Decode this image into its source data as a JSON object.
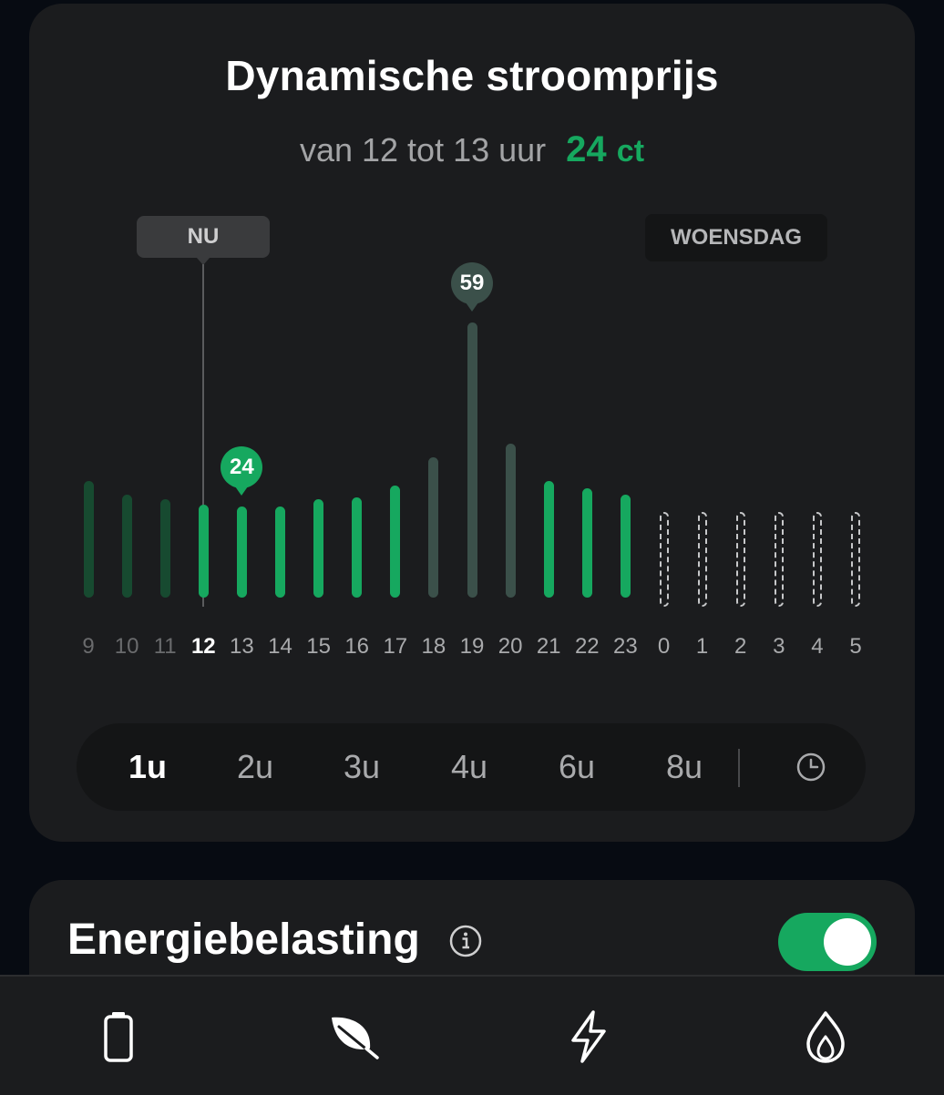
{
  "price_card": {
    "title": "Dynamische stroomprijs",
    "subtitle": "van 12 tot 13 uur",
    "price_value": "24",
    "price_unit": "ct",
    "now_label": "NU",
    "day_label": "WOENSDAG"
  },
  "chart_data": {
    "type": "bar",
    "categories": [
      "9",
      "10",
      "11",
      "12",
      "13",
      "14",
      "15",
      "16",
      "17",
      "18",
      "19",
      "20",
      "21",
      "22",
      "23",
      "0",
      "1",
      "2",
      "3",
      "4",
      "5"
    ],
    "values": [
      25,
      22,
      21,
      20,
      19.5,
      19.5,
      21,
      21.5,
      24,
      30,
      59,
      33,
      25,
      23.5,
      22,
      null,
      null,
      null,
      null,
      null,
      null
    ],
    "current_index": 3,
    "highlight_labels": [
      {
        "index": 4,
        "label": "24",
        "color": "#16a85f"
      },
      {
        "index": 10,
        "label": "59",
        "color": "#3b504a"
      }
    ],
    "colors": {
      "past": "#174a30",
      "low": "#16a85f",
      "high": "#3b504a",
      "unknown": "#c7c8ca"
    }
  },
  "range_options": [
    {
      "label": "1u",
      "active": true
    },
    {
      "label": "2u",
      "active": false
    },
    {
      "label": "3u",
      "active": false
    },
    {
      "label": "4u",
      "active": false
    },
    {
      "label": "6u",
      "active": false
    },
    {
      "label": "8u",
      "active": false
    }
  ],
  "range_icon": "clock-icon",
  "tax_card": {
    "title": "Energiebelasting",
    "info_icon": "info-icon",
    "toggle_on": true
  },
  "navbar": {
    "items": [
      "battery-icon",
      "leaf-icon",
      "lightning-icon",
      "flame-icon"
    ]
  }
}
